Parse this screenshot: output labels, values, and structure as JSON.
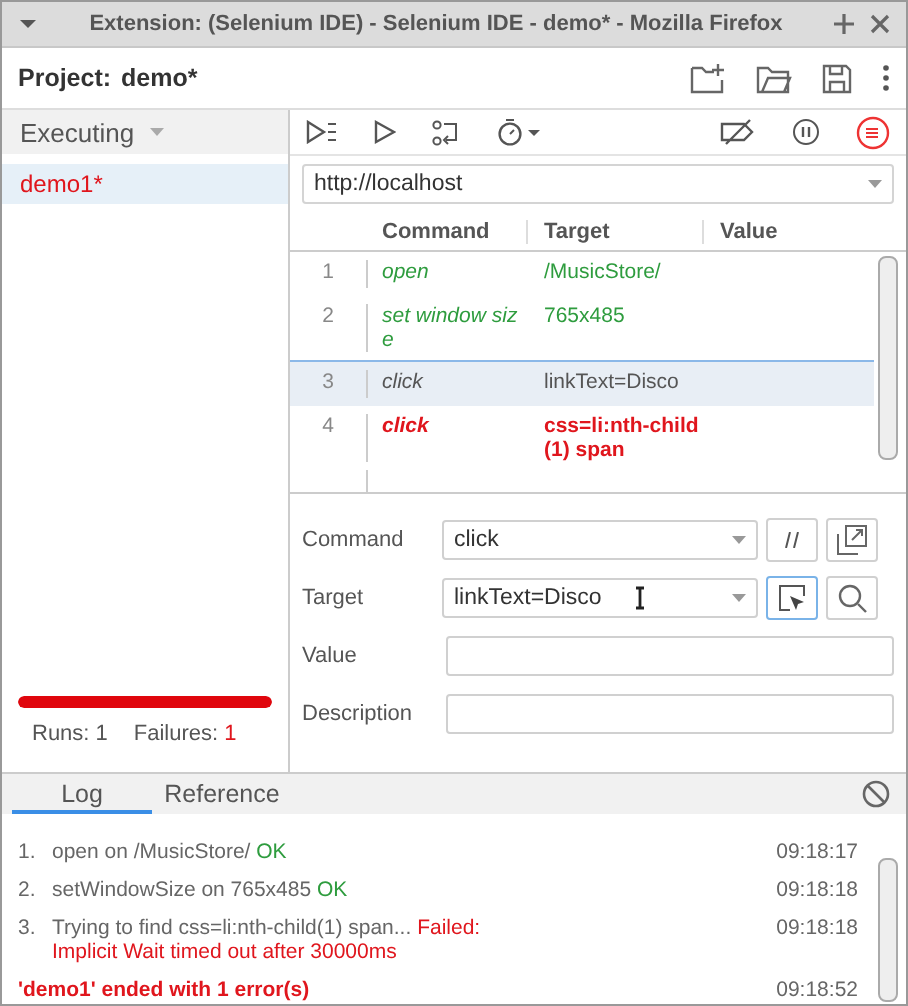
{
  "window": {
    "title": "Extension: (Selenium IDE) - Selenium IDE - demo* - Mozilla Firefox"
  },
  "project": {
    "label": "Project:",
    "name": "demo*"
  },
  "sidebar": {
    "mode": "Executing",
    "tests": [
      {
        "name": "demo1*",
        "selected": true,
        "failed": true
      }
    ],
    "progress": {
      "level": 1,
      "failed": true
    },
    "runs_label": "Runs:",
    "runs": "1",
    "failures_label": "Failures:",
    "failures": "1"
  },
  "url": "http://localhost",
  "table": {
    "columns": [
      "Command",
      "Target",
      "Value"
    ],
    "rows": [
      {
        "index": "1",
        "command": "open",
        "target": "/MusicStore/",
        "passed": true,
        "failed": false,
        "selected": false
      },
      {
        "index": "2",
        "command": "set window size",
        "target": "765x485",
        "passed": true,
        "failed": false,
        "selected": false
      },
      {
        "index": "3",
        "command": "click",
        "target": "linkText=Disco",
        "passed": false,
        "failed": false,
        "selected": true
      },
      {
        "index": "4",
        "command": "click",
        "target": "css=li:nth-child(1) span",
        "passed": false,
        "failed": true,
        "selected": false
      }
    ]
  },
  "editor": {
    "command_label": "Command",
    "command": "click",
    "target_label": "Target",
    "target": "linkText=Disco",
    "value_label": "Value",
    "description_label": "Description"
  },
  "bottom_tabs": [
    {
      "label": "Log",
      "selected": true
    },
    {
      "label": "Reference",
      "selected": false
    }
  ],
  "log": [
    {
      "kind": "step",
      "number": "1.",
      "text": "open on /MusicStore/",
      "result": "OK",
      "failed": false,
      "time": "09:18:17"
    },
    {
      "kind": "step",
      "number": "2.",
      "text": "setWindowSize on 765x485",
      "result": "OK",
      "failed": false,
      "time": "09:18:18"
    },
    {
      "kind": "step",
      "number": "3.",
      "text": "Trying to find css=li:nth-child(1) span...",
      "result": "Failed:",
      "detail": "Implicit Wait timed out after 30000ms",
      "failed": true,
      "time": "09:18:18"
    },
    {
      "kind": "summary",
      "text": "'demo1' ended with 1 error(s)",
      "failed": true,
      "time": "09:18:52"
    }
  ]
}
